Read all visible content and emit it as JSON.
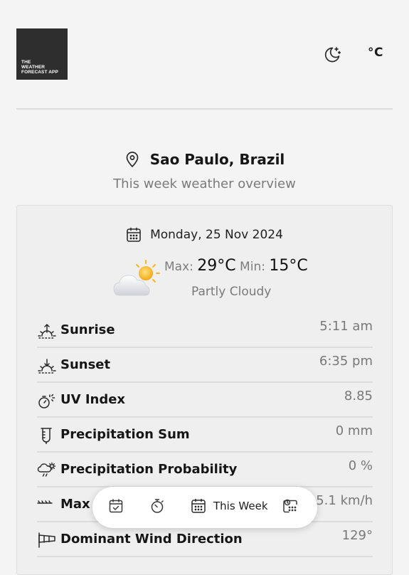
{
  "header": {
    "logo_lines": [
      "THE",
      "WEATHER",
      "FORECAST APP"
    ],
    "theme_icon": "moon-stars-icon",
    "unit_label": "°C"
  },
  "location": {
    "icon": "map-pin-icon",
    "name": "Sao Paulo, Brazil",
    "subtitle": "This week weather overview"
  },
  "day": {
    "date_icon": "calendar-icon",
    "date": "Monday, 25 Nov 2024",
    "weather_icon": "partly-cloudy-icon",
    "max_label": "Max:",
    "max_value": "29°C",
    "min_label": "Min:",
    "min_value": "15°C",
    "condition": "Partly Cloudy"
  },
  "details": [
    {
      "icon": "sunrise-icon",
      "label": "Sunrise",
      "value": "5:11 am"
    },
    {
      "icon": "sunset-icon",
      "label": "Sunset",
      "value": "6:35 pm"
    },
    {
      "icon": "uv-index-icon",
      "label": "UV Index",
      "value": "8.85"
    },
    {
      "icon": "rain-gauge-icon",
      "label": "Precipitation Sum",
      "value": "0 mm"
    },
    {
      "icon": "cloud-sun-rain-icon",
      "label": "Precipitation Probability",
      "value": "0 %"
    },
    {
      "icon": "wind-icon",
      "label": "Max",
      "value": "15.1 km/h"
    },
    {
      "icon": "windsock-icon",
      "label": "Dominant Wind Direction",
      "value": "129°"
    }
  ],
  "nav": {
    "items": [
      {
        "icon": "calendar-check-icon",
        "label": ""
      },
      {
        "icon": "stopwatch-icon",
        "label": ""
      },
      {
        "icon": "calendar-week-icon",
        "label": "This Week"
      },
      {
        "icon": "calendar-clock-icon",
        "label": ""
      }
    ]
  },
  "colors": {
    "background": "#f4f4f4",
    "card": "#efefef",
    "logo_bg": "#2e2e2e",
    "sun": "#f6b81f",
    "divider": "#dcdcdc"
  }
}
